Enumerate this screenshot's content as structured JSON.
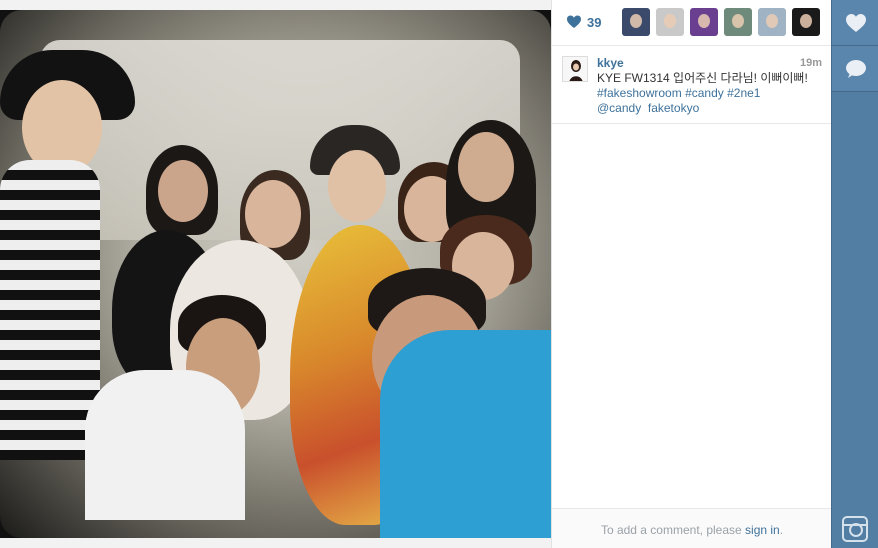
{
  "post": {
    "like_count": "39",
    "likers": [
      {
        "name": "liker-1",
        "color": "#3b4a6b"
      },
      {
        "name": "liker-2",
        "color": "#c9c9c9"
      },
      {
        "name": "liker-3",
        "color": "#6a3f8f"
      },
      {
        "name": "liker-4",
        "color": "#6d8a7a"
      },
      {
        "name": "liker-5",
        "color": "#9fb3c5"
      },
      {
        "name": "liker-6",
        "color": "#1a1a1a"
      }
    ]
  },
  "caption": {
    "username": "kkye",
    "time": "19m",
    "text_line1": "KYE FW1314 입어주신 다라님! 이뻐이뻐!",
    "hashtag1": "#fakeshowroom",
    "hashtag2": "#candy",
    "hashtag3": "#2ne1",
    "mention1": "@candy",
    "mention2": "faketokyo"
  },
  "comment": {
    "prompt": "To add a comment, please",
    "signin": "sign in",
    "suffix": "."
  },
  "icons": {
    "like": "heart-icon",
    "comment": "comment-icon",
    "logo": "instagram-icon"
  },
  "colors": {
    "accent": "#3f729b",
    "sidebar": "#527ea4"
  }
}
